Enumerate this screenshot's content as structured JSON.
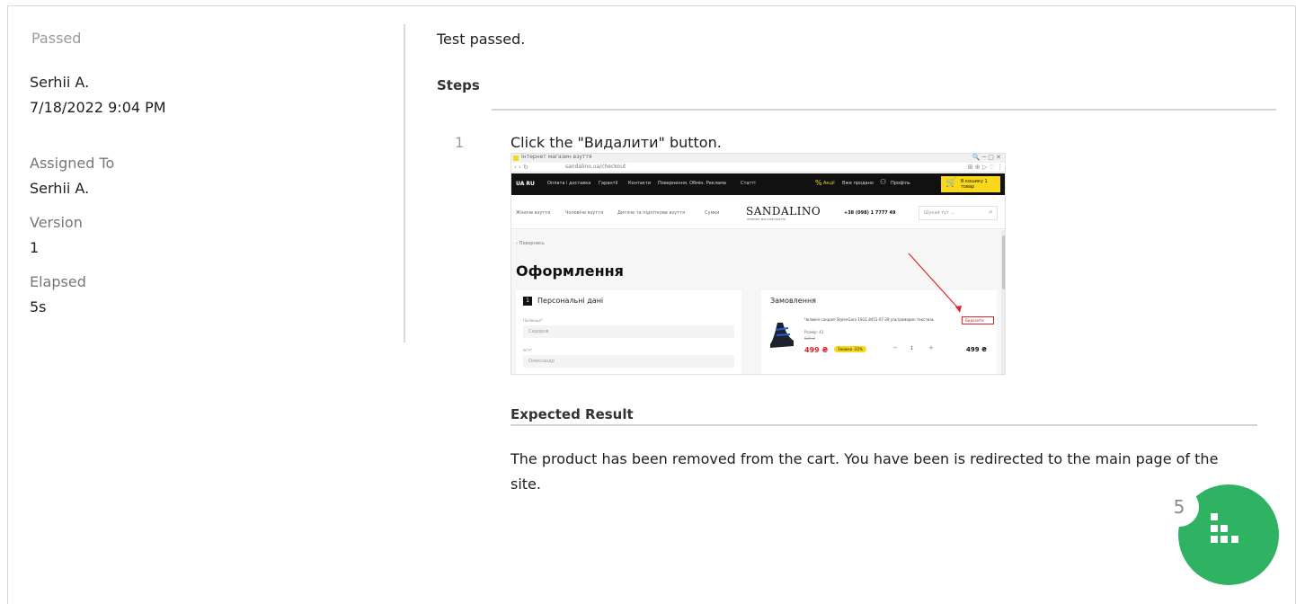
{
  "sidebar": {
    "status": "Passed",
    "author": "Serhii A.",
    "datetime": "7/18/2022 9:04 PM",
    "assigned_to_label": "Assigned To",
    "assigned_to_value": "Serhii A.",
    "version_label": "Version",
    "version_value": "1",
    "elapsed_label": "Elapsed",
    "elapsed_value": "5s"
  },
  "main": {
    "result_text": "Test passed.",
    "steps_heading": "Steps",
    "steps": [
      {
        "number": "1",
        "text": "Click the \"Видалити\" button."
      }
    ],
    "expected_heading": "Expected Result",
    "expected_text": "The product has been removed from the cart. You have been is redirected to the main page of the site."
  },
  "screenshot": {
    "tab_title": "Інтернет магазин взуття",
    "url": "sandalino.ua/checkout",
    "topbar_lang": "UA RU",
    "topbar_links": [
      "Оплата і доставка",
      "Гарантії",
      "Контакти",
      "Повернення. Обмін. Реклама",
      "Статті"
    ],
    "topbar_right": [
      "Акції",
      "Вже продано",
      "Профіль"
    ],
    "cart_label": "В кошику 1 товар",
    "nav_links": [
      "Жіноче взуття",
      "Чоловіче взуття",
      "Дитяче та підліткове взуття",
      "Сумки"
    ],
    "logo": "SANDALINO",
    "logo_sub": "ІНТЕРНЕТ-МАГАЗИН ВЗУТТЯ",
    "phone": "+38 (098) 1 7777 49",
    "search_placeholder": "Шукай тут ...",
    "back_link": "‹ Повернись",
    "page_title": "Оформлення",
    "section_personal_num": "1",
    "section_personal": "Персональні дані",
    "field_surname_label": "Прізвище*",
    "field_surname_value": "Сидоров",
    "field_name_label": "Ім'я*",
    "field_name_value": "Олександр",
    "order_title": "Замовлення",
    "product_name": "Чоловічі сандалі StylenGaro 1SG1 8451-07-28 ультрамарин текстиль",
    "product_size": "Розмір: 41",
    "old_price": "639 ₴",
    "price": "499 ₴",
    "discount": "Знижка -22%",
    "qty": "1",
    "total": "499 ₴",
    "delete_button": "Видалити"
  },
  "fab": {
    "count": "5",
    "color": "#2fb363"
  },
  "colors": {
    "accent_yellow": "#f9d81b",
    "topbar": "#111111",
    "highlight_red": "#d9262b",
    "price_red": "#d9262b"
  }
}
